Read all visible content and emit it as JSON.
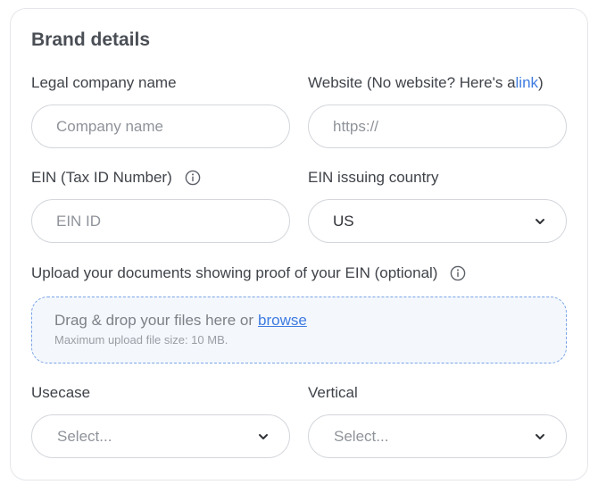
{
  "form": {
    "title": "Brand details",
    "legal_name": {
      "label": "Legal company name",
      "placeholder": "Company name"
    },
    "website": {
      "label_prefix": "Website (No website? Here's a ",
      "link_text": "link",
      "label_suffix": ")",
      "placeholder": "https://"
    },
    "ein": {
      "label": "EIN (Tax ID Number)",
      "placeholder": "EIN ID"
    },
    "ein_country": {
      "label": "EIN issuing country",
      "value": "US"
    },
    "upload": {
      "label": "Upload your documents showing proof of your EIN (optional)",
      "drop_text": "Drag & drop your files here or",
      "browse_text": "browse",
      "max_size_text": "Maximum upload file size: 10 MB."
    },
    "usecase": {
      "label": "Usecase",
      "value": "Select..."
    },
    "vertical": {
      "label": "Vertical",
      "value": "Select..."
    }
  },
  "icons": {
    "info": "info-icon",
    "chevron": "chevron-down-icon"
  },
  "colors": {
    "link": "#3f7be0",
    "border": "#d3d6db",
    "dropzone_border": "#7aa3e6",
    "dropzone_bg": "#f4f8fd"
  }
}
